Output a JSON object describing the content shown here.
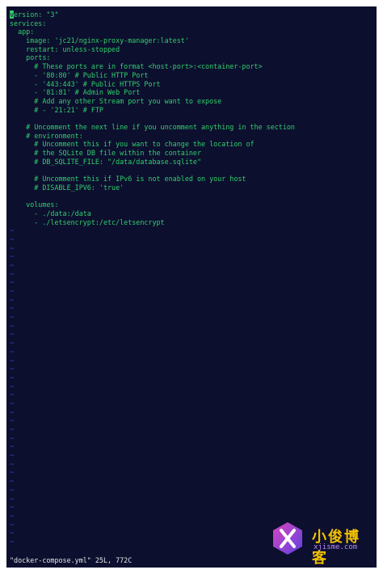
{
  "editor": {
    "lines": [
      "version: \"3\"",
      "services:",
      "  app:",
      "    image: 'jc21/nginx-proxy-manager:latest'",
      "    restart: unless-stopped",
      "    ports:",
      "      # These ports are in format <host-port>:<container-port>",
      "      - '80:80' # Public HTTP Port",
      "      - '443:443' # Public HTTPS Port",
      "      - '81:81' # Admin Web Port",
      "      # Add any other Stream port you want to expose",
      "      # - '21:21' # FTP",
      "",
      "    # Uncomment the next line if you uncomment anything in the section",
      "    # environment:",
      "      # Uncomment this if you want to change the location of",
      "      # the SQLite DB file within the container",
      "      # DB_SQLITE_FILE: \"/data/database.sqlite\"",
      "",
      "      # Uncomment this if IPv6 is not enabled on your host",
      "      # DISABLE_IPV6: 'true'",
      "",
      "    volumes:",
      "      - ./data:/data",
      "      - ./letsencrypt:/etc/letsencrypt"
    ],
    "tilde_char": "~",
    "status_line": "\"docker-compose.yml\" 25L, 772C"
  },
  "watermark": {
    "title": "小俊博客",
    "subtitle": "xjisme.com"
  },
  "colors": {
    "background": "#0d0f2f",
    "text": "#2fd06a",
    "tilde": "#3c46c8",
    "status": "#e6e6e6"
  }
}
